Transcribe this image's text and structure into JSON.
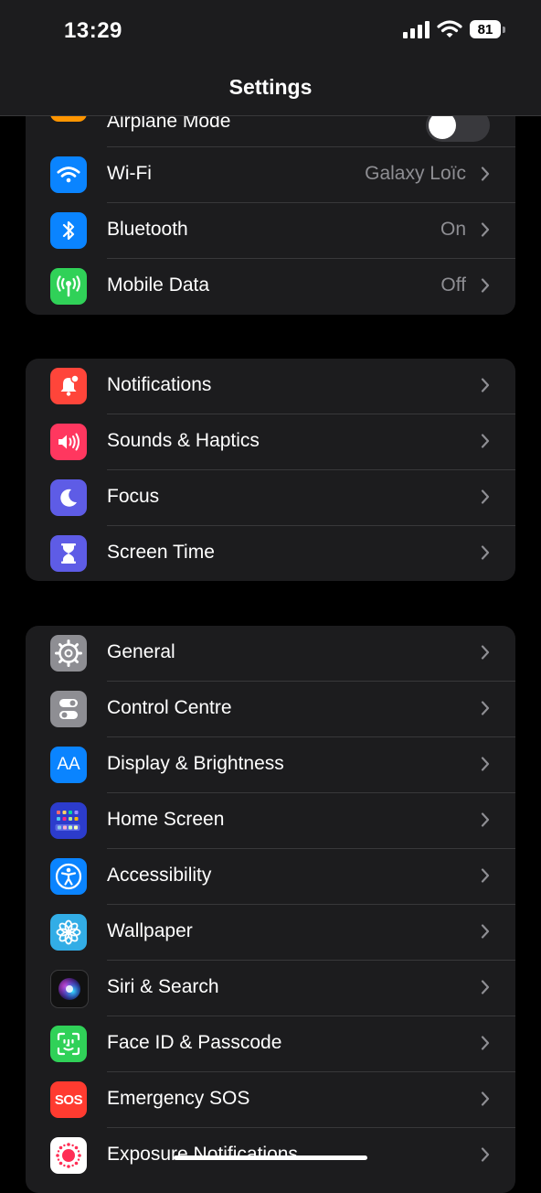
{
  "status_bar": {
    "time": "13:29",
    "battery": "81"
  },
  "nav": {
    "title": "Settings"
  },
  "groups": [
    {
      "rows": [
        {
          "label": "Airplane Mode",
          "icon": "airplane-icon",
          "color": "#ff9500",
          "toggle": false
        },
        {
          "label": "Wi-Fi",
          "value": "Galaxy Loïc",
          "icon": "wifi-icon",
          "color": "#0a84ff"
        },
        {
          "label": "Bluetooth",
          "value": "On",
          "icon": "bluetooth-icon",
          "color": "#0a84ff"
        },
        {
          "label": "Mobile Data",
          "value": "Off",
          "icon": "antenna-icon",
          "color": "#30d158"
        }
      ]
    },
    {
      "rows": [
        {
          "label": "Notifications",
          "icon": "bell-icon",
          "color": "#ff453a"
        },
        {
          "label": "Sounds & Haptics",
          "icon": "speaker-icon",
          "color": "#ff375f"
        },
        {
          "label": "Focus",
          "icon": "moon-icon",
          "color": "#5e5ce6"
        },
        {
          "label": "Screen Time",
          "icon": "hourglass-icon",
          "color": "#5e5ce6"
        }
      ]
    },
    {
      "rows": [
        {
          "label": "General",
          "icon": "gear-icon",
          "color": "#8e8e93"
        },
        {
          "label": "Control Centre",
          "icon": "switches-icon",
          "color": "#8e8e93"
        },
        {
          "label": "Display & Brightness",
          "icon": "text-size-icon",
          "icon_text": "AA",
          "color": "#0a84ff"
        },
        {
          "label": "Home Screen",
          "icon": "app-grid-icon",
          "color": "#2c3ccc"
        },
        {
          "label": "Accessibility",
          "icon": "accessibility-icon",
          "color": "#0a84ff"
        },
        {
          "label": "Wallpaper",
          "icon": "flower-icon",
          "color": "#32ade6"
        },
        {
          "label": "Siri & Search",
          "icon": "siri-icon",
          "color": "#1c1c1e"
        },
        {
          "label": "Face ID & Passcode",
          "icon": "face-id-icon",
          "color": "#30d158"
        },
        {
          "label": "Emergency SOS",
          "icon": "sos-icon",
          "icon_text": "SOS",
          "color": "#ff3b30"
        },
        {
          "label": "Exposure Notifications",
          "icon": "exposure-icon",
          "color": "#ffffff"
        }
      ]
    }
  ]
}
